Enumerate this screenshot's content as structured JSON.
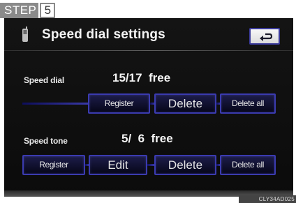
{
  "step": {
    "word": "STEP",
    "number": "5"
  },
  "header": {
    "title": "Speed dial settings",
    "back_icon": "return-arrow-icon",
    "phone_icon": "cellphone-icon"
  },
  "speed_dial": {
    "label": "Speed dial",
    "free_text": "15/17  free",
    "buttons": {
      "register": "Register",
      "delete": "Delete",
      "delete_all": "Delete all"
    }
  },
  "speed_tone": {
    "label": "Speed tone",
    "free_text": "5/  6  free",
    "buttons": {
      "register": "Register",
      "edit": "Edit",
      "delete": "Delete",
      "delete_all": "Delete all"
    }
  },
  "image_code": "CLY34AD025",
  "colors": {
    "button_border": "#3b3bb0",
    "screen_bg": "#0b0b0b",
    "track": "#2a2aa0"
  }
}
